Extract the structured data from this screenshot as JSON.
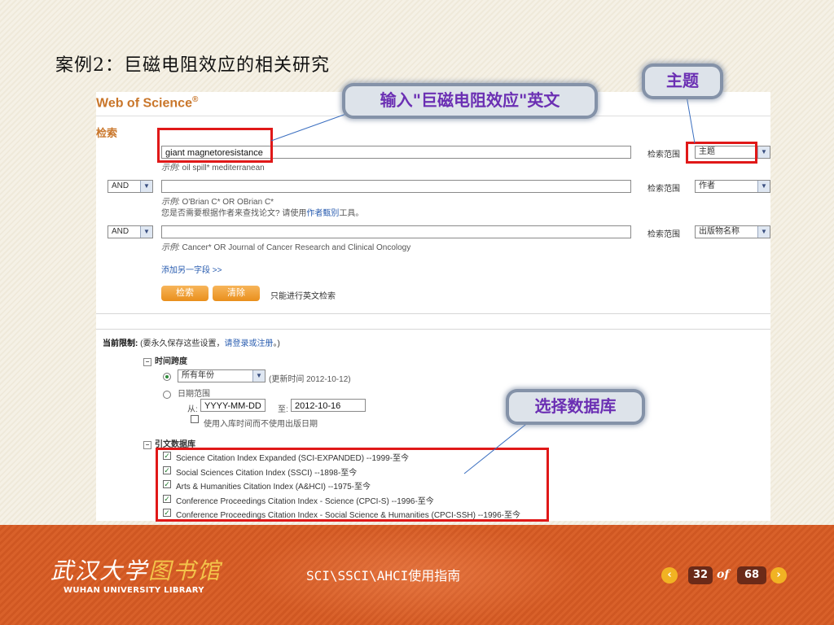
{
  "slide": {
    "title": "案例2：巨磁电阻效应的相关研究"
  },
  "wos": {
    "logo": "Web of Science",
    "logo_mark": "®",
    "search_heading": "检索",
    "rows": [
      {
        "operator": "",
        "value": "giant magnetoresistance",
        "hint_prefix": "示例:",
        "hint": " oil spill* mediterranean",
        "scope_label": "检索范围",
        "scope": "主题"
      },
      {
        "operator": "AND",
        "value": "",
        "hint_prefix": "示例:",
        "hint": " O'Brian C* OR OBrian C*",
        "hint2_prefix": "您是否需要根据作者来查找论文? 请使用",
        "hint2_link": "作者甄别",
        "hint2_suffix": "工具。",
        "scope_label": "检索范围",
        "scope": "作者"
      },
      {
        "operator": "AND",
        "value": "",
        "hint_prefix": "示例:",
        "hint": " Cancer* OR Journal of Cancer Research and Clinical Oncology",
        "scope_label": "检索范围",
        "scope": "出版物名称"
      }
    ],
    "add_field": "添加另一字段 >>",
    "search_btn": "检索",
    "clear_btn": "清除",
    "english_only": "只能进行英文检索",
    "limits": {
      "label": "当前限制:",
      "text_prefix": " (要永久保存这些设置，",
      "text_link": "请登录或注册",
      "text_suffix": "。)"
    },
    "timespan": {
      "heading": "时间跨度",
      "all_years": "所有年份",
      "updated": "(更新时间  2012-10-12)",
      "date_range": "日期范围",
      "from_label": "从:",
      "from_value": "YYYY-MM-DD",
      "to_label": "至:",
      "to_value": "2012-10-16",
      "use_index_date": "使用入库时间而不使用出版日期"
    },
    "databases": {
      "heading": "引文数据库",
      "items": [
        "Science Citation Index Expanded (SCI-EXPANDED) --1999-至今",
        "Social Sciences Citation Index (SSCI) --1898-至今",
        "Arts & Humanities Citation Index (A&HCI) --1975-至今",
        "Conference Proceedings Citation Index - Science (CPCI-S) --1996-至今",
        "Conference Proceedings Citation Index - Social Science & Humanities (CPCI-SSH) --1996-至今"
      ]
    }
  },
  "callouts": {
    "input": "输入\"巨磁电阻效应\"英文",
    "topic": "主题",
    "database": "选择数据库"
  },
  "footer": {
    "logo_cn_1": "武汉大学",
    "logo_cn_2": "图书馆",
    "logo_en": "WUHAN UNIVERSITY LIBRARY",
    "title": "SCI\\SSCI\\AHCI使用指南",
    "page": "32",
    "of": "of",
    "total": "68",
    "prev_icon": "chevron-left-icon",
    "next_icon": "chevron-right-icon"
  }
}
